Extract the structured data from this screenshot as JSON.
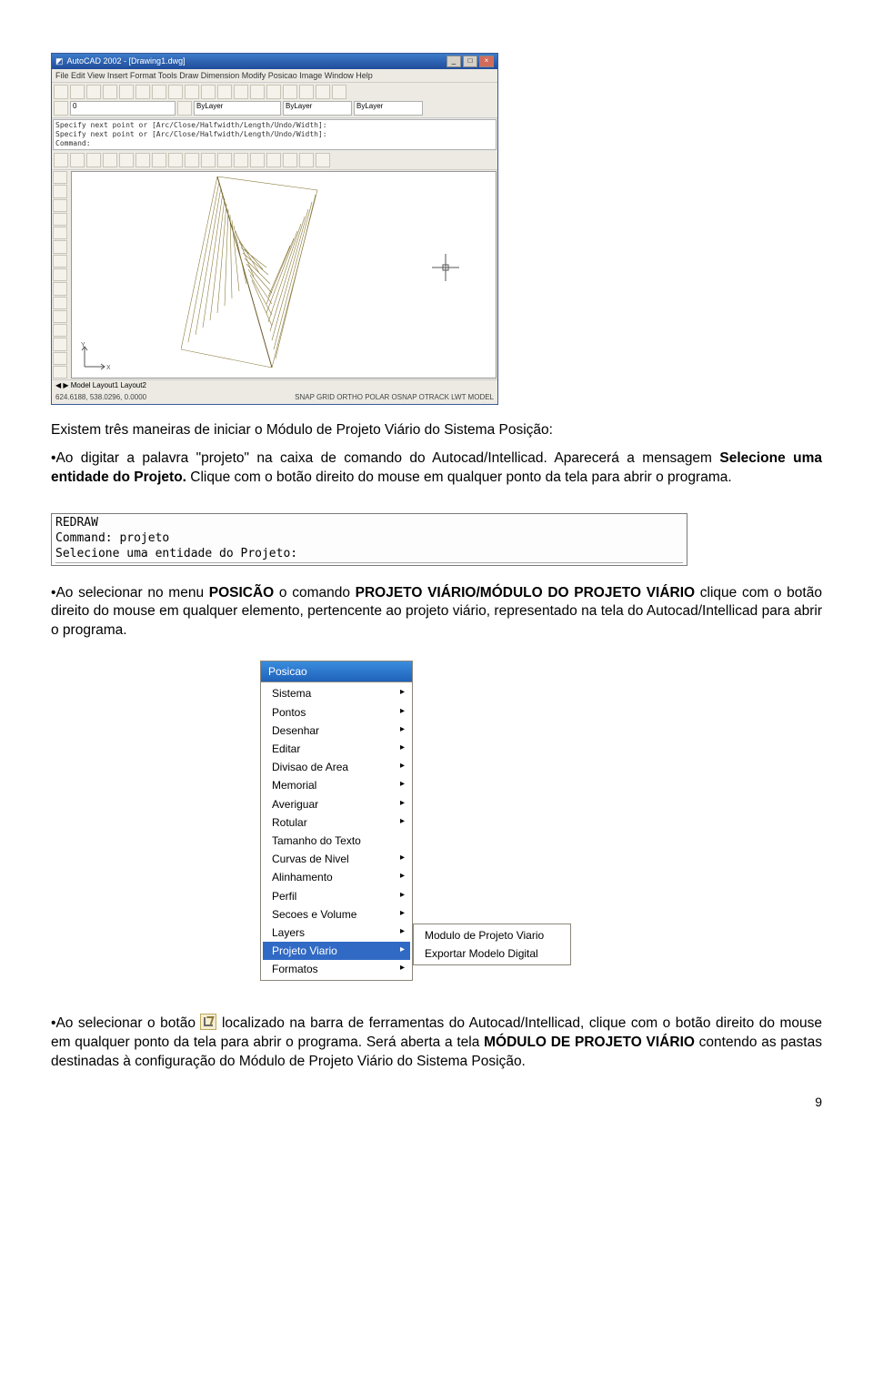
{
  "acad": {
    "title": "AutoCAD 2002 - [Drawing1.dwg]",
    "menu": "File  Edit  View  Insert  Format  Tools  Draw  Dimension  Modify  Posicao  Image  Window  Help",
    "layer_box": "0",
    "style_box": "ByLayer",
    "cmd_lines": [
      "Specify next point or [Arc/Close/Halfwidth/Length/Undo/Width]:",
      "Specify next point or [Arc/Close/Halfwidth/Length/Undo/Width]:",
      "Command:"
    ],
    "tabs": "◀ ▶  Model  Layout1  Layout2",
    "status_left": "624.6188, 538.0296, 0.0000",
    "status_right": "SNAP  GRID  ORTHO  POLAR  OSNAP  OTRACK  LWT  MODEL"
  },
  "para1_a": "Existem três maneiras de iniciar o Módulo de Projeto Viário do Sistema Posição:",
  "para1_b_pre": "Ao digitar a palavra \"projeto\" na caixa de comando do Autocad/Intellicad. Aparecerá a mensagem ",
  "para1_b_bold": "Selecione uma entidade do Projeto.",
  "para1_b_post": " Clique com o botão direito do mouse em qualquer ponto da tela para abrir o programa.",
  "cmdbox": {
    "l1": "REDRAW",
    "l2": "Command: projeto",
    "l3": "Selecione uma entidade do Projeto:"
  },
  "para2_pre": "Ao selecionar no menu ",
  "para2_b1": "POSICÃO",
  "para2_mid": " o comando ",
  "para2_b2": "PROJETO VIÁRIO/MÓDULO DO PROJETO VIÁRIO",
  "para2_post": " clique com o botão direito do mouse em qualquer elemento, pertencente ao projeto viário, representado na tela do Autocad/Intellicad para abrir o programa.",
  "menu": {
    "header": "Posicao",
    "items": [
      "Sistema",
      "Pontos",
      "Desenhar",
      "Editar",
      "Divisao de Area",
      "Memorial",
      "Averiguar",
      "Rotular",
      "Tamanho do Texto",
      "Curvas de Nivel",
      "Alinhamento",
      "Perfil",
      "Secoes e Volume",
      "Layers",
      "Projeto Viario",
      "Formatos"
    ],
    "sub": [
      "Modulo de Projeto Viario",
      "Exportar Modelo Digital"
    ]
  },
  "para3_pre": "Ao selecionar o botão ",
  "para3_mid": " localizado na barra de ferramentas do Autocad/Intellicad, clique com o botão direito do mouse em qualquer ponto da tela para abrir o programa. Será aberta a tela ",
  "para3_b": "MÓDULO DE PROJETO VIÁRIO",
  "para3_post": " contendo as pastas destinadas à configuração do Módulo de Projeto Viário do Sistema Posição.",
  "page": "9"
}
